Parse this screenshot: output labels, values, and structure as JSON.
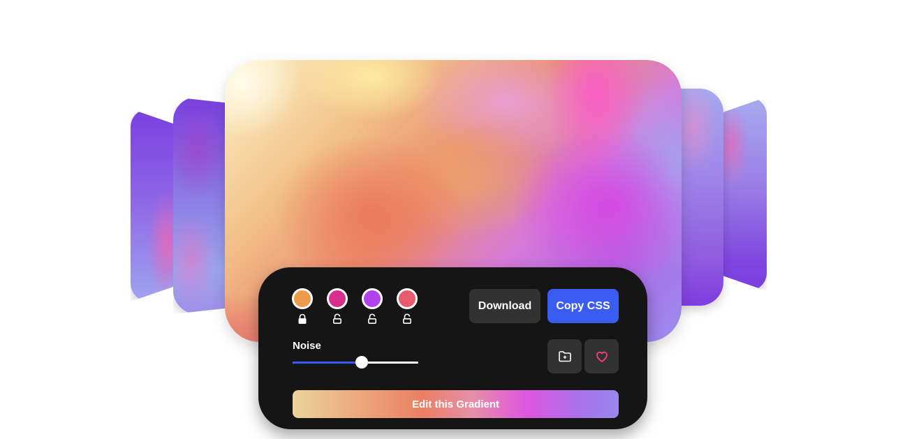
{
  "swatches": [
    {
      "color": "#ed9a4b",
      "locked": true,
      "lock_icon": "lock-closed-icon"
    },
    {
      "color": "#d92f8c",
      "locked": false,
      "lock_icon": "lock-open-icon"
    },
    {
      "color": "#b243ea",
      "locked": false,
      "lock_icon": "lock-open-icon"
    },
    {
      "color": "#e85a6c",
      "locked": false,
      "lock_icon": "lock-open-icon"
    }
  ],
  "actions": {
    "download_label": "Download",
    "copy_css_label": "Copy CSS",
    "save_icon": "folder-plus-icon",
    "favorite_icon": "heart-icon"
  },
  "noise": {
    "label": "Noise",
    "value_fraction": 0.55
  },
  "edit_label": "Edit this Gradient",
  "colors": {
    "panel_bg": "#151515",
    "accent_blue": "#3b5cf0",
    "secondary_button": "#323232",
    "heart": "#ff3d7f"
  }
}
